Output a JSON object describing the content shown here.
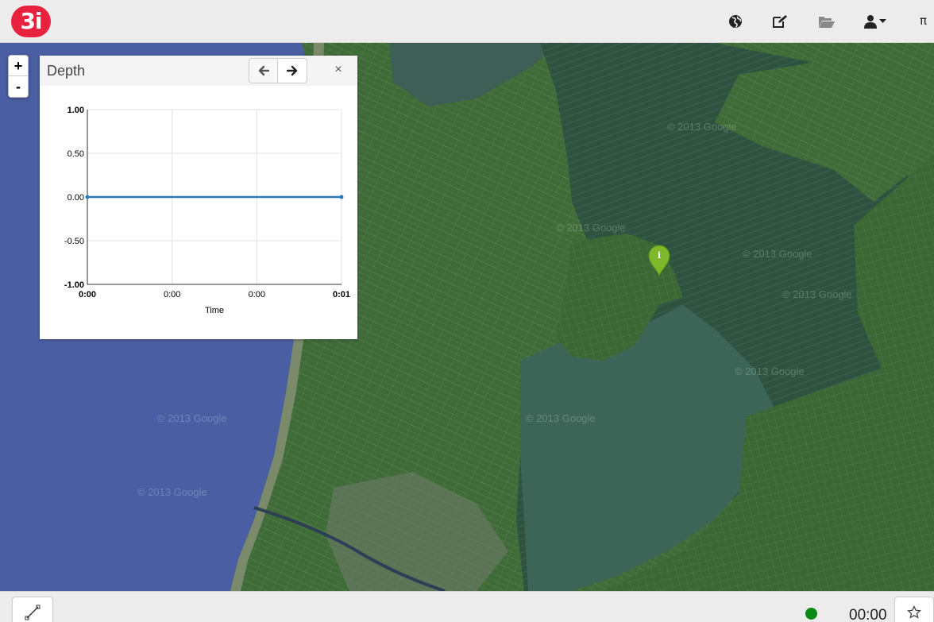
{
  "app": {
    "logo_text": "3i"
  },
  "navbar": {
    "icons": [
      "globe-icon",
      "edit-icon",
      "folder-open-icon",
      "user-icon",
      "caret-down-icon"
    ],
    "pi_text": "π"
  },
  "map": {
    "zoom_in": "+",
    "zoom_out": "-",
    "watermark": "© 2013 Google",
    "marker_label": "i",
    "colors": {
      "sea": "#4a5fa3",
      "land": "#3e6b38",
      "lake": "#355a44",
      "marker": "#7cb82a"
    }
  },
  "panel": {
    "title": "Depth",
    "prev_icon": "arrow-left-icon",
    "next_icon": "arrow-right-icon",
    "close_label": "×"
  },
  "chart_data": {
    "type": "line",
    "title": "",
    "xlabel": "Time",
    "ylabel": "",
    "x_ticks": [
      "0:00",
      "0:00",
      "0:00",
      "0:01"
    ],
    "y_ticks": [
      "1.00",
      "0.50",
      "0.00",
      "-0.50",
      "-1.00"
    ],
    "ylim": [
      -1,
      1
    ],
    "grid": true,
    "series": [
      {
        "values": [
          0,
          0
        ],
        "color": "#2a7ab8"
      }
    ]
  },
  "bottombar": {
    "tool_icon": "measure-line-icon",
    "status_color": "#0a8a16",
    "clock": "00:00",
    "star_icon": "star-icon"
  }
}
